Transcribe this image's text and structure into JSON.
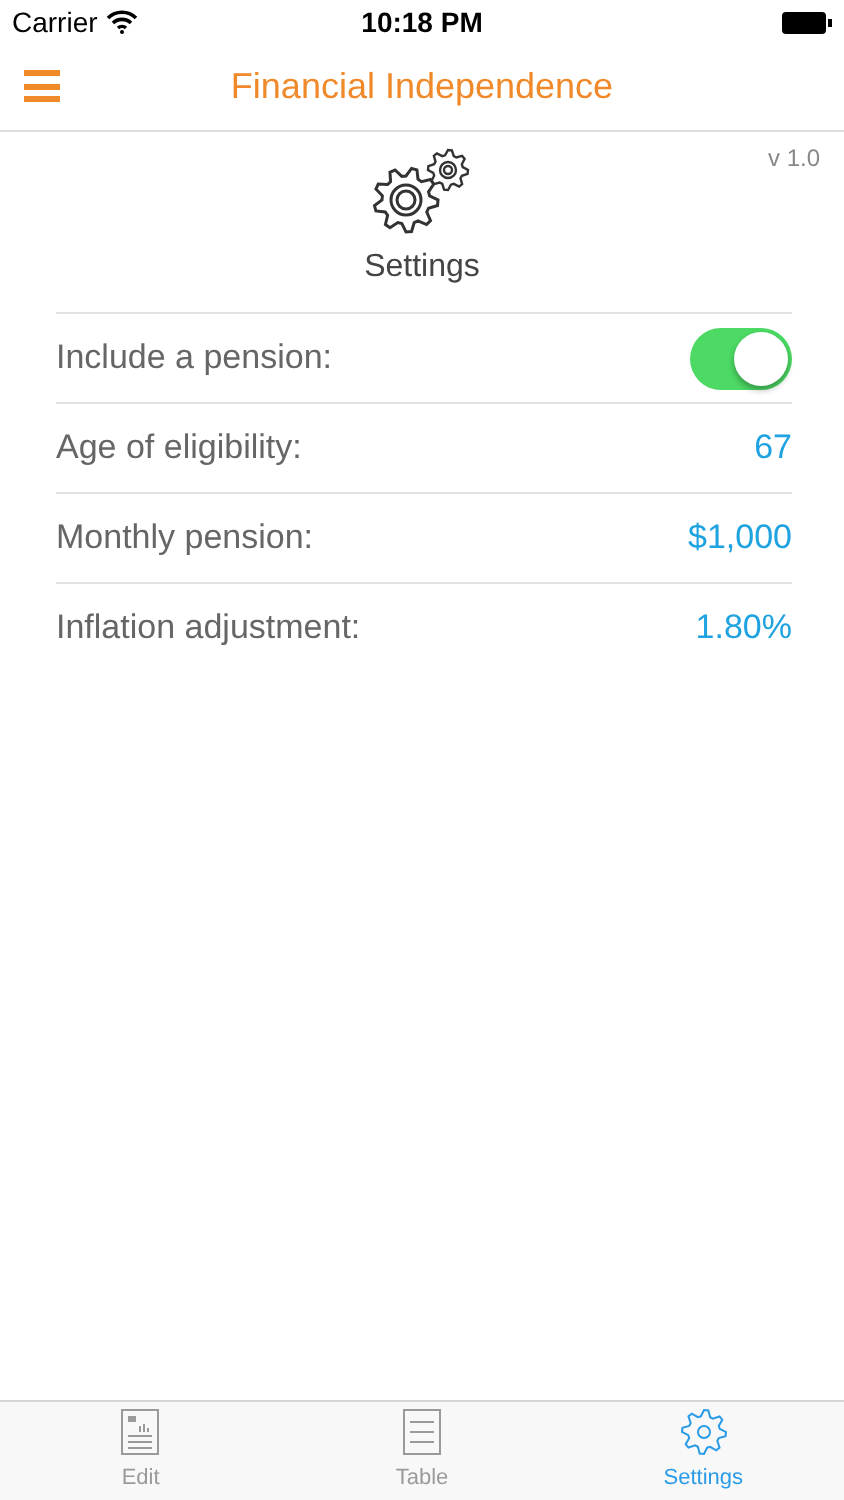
{
  "status_bar": {
    "carrier": "Carrier",
    "time": "10:18 PM"
  },
  "nav": {
    "title": "Financial Independence"
  },
  "version": "v 1.0",
  "header": {
    "label": "Settings"
  },
  "rows": [
    {
      "kind": "toggle",
      "label": "Include a pension:",
      "on": true
    },
    {
      "kind": "value",
      "label": "Age of eligibility:",
      "value": "67"
    },
    {
      "kind": "value",
      "label": "Monthly pension:",
      "value": "$1,000"
    },
    {
      "kind": "value",
      "label": "Inflation adjustment:",
      "value": "1.80%"
    }
  ],
  "tabs": [
    {
      "kind": "edit",
      "label": "Edit",
      "selected": false
    },
    {
      "kind": "table",
      "label": "Table",
      "selected": false
    },
    {
      "kind": "settings",
      "label": "Settings",
      "selected": true
    }
  ]
}
